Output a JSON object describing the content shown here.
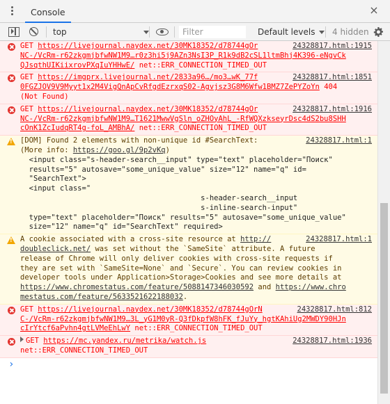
{
  "tabs": [
    {
      "label": "Console"
    }
  ],
  "toolbar": {
    "context": "top",
    "filter_placeholder": "Filter",
    "levels_label": "Default levels",
    "hidden_count": "4 hidden"
  },
  "messages": [
    {
      "type": "error",
      "method": "GET",
      "url_l1": "https://livejournal.naydex.net/30MK18352/d78744gOr",
      "url_l2": "NC-/VcRm-r62zkgmjbfwNW1M9…r0z3hi5j9AZn3NsI3P_R1k9dB2cSL1ltmBhj4K396-eNgvCk",
      "url_l3": "QJsqthUIKiixrovPXqIuYHHwE/",
      "tail": "net::ERR_CONNECTION_TIMED_OUT",
      "source": "24328817.html:1915"
    },
    {
      "type": "error",
      "method": "GET",
      "url_l1": "https://imgprx.livejournal.net/2833a96…/mo3…wK_77f",
      "url_l2": "0FGZJOV9V9Myyt1x2M4VigQnApCvRfgdEzrxqS02-Agvjsz3G8M6Wfw1BMZ7ZePYZoYn",
      "code": "404",
      "tail": "(Not Found)",
      "source": "24328817.html:1851"
    },
    {
      "type": "error",
      "method": "GET",
      "url_l1": "https://livejournal.naydex.net/30MK18352/d78744gOr",
      "url_l2": "NC-/VcRm-r62zkgmjbfwNW1M9…T1621MwwVgSln_oZHOyAhL_-RfWQXzkseyrDsc4dS2bu8SHH",
      "url_l3": "cOnK1ZcIudqRT4g-foL_AMBhA/",
      "tail": "net::ERR_CONNECTION_TIMED_OUT",
      "source": "24328817.html:1916"
    },
    {
      "type": "warn",
      "text_l1": "[DOM] Found 2 elements with non-unique id #SearchText:",
      "text_l2": "(More info: ",
      "link": "https://goo.gl/9p2vKq",
      "text_l2_end": ")",
      "source": "24328817.html:1",
      "code_lines": [
        "  <input class=\"s-header-search__input\" type=\"text\" placeholder=\"Поиск\"",
        "  results=\"5\" autosave=\"some_unique_value\" size=\"12\" name=\"q\" id=",
        "  \"SearchText\">",
        "  <input class=\"",
        "                                         s-header-search__input",
        "                                         s-inline-search-input\"",
        "  type=\"text\" placeholder=\"Поиск\" results=\"5\" autosave=\"some_unique_value\"",
        "  size=\"12\" name=\"q\" id=\"SearchText\" required>"
      ]
    },
    {
      "type": "warn",
      "pre": "A cookie associated with a cross-site resource at ",
      "link1_a": "http://",
      "link1_b": "doubleclick.net/",
      "rest_l1": " was set without the `SameSite` attribute. A future",
      "rest_l2": "release of Chrome will only deliver cookies with cross-site requests if",
      "rest_l3": "they are set with `SameSite=None` and `Secure`. You can review cookies in",
      "rest_l4": "developer tools under Application>Storage>Cookies and see more details at",
      "link2": "https://www.chromestatus.com/feature/5088147346030592",
      "and": " and ",
      "link3_a": "https://www.chro",
      "link3_b": "mestatus.com/feature/5633521622188032",
      "end": ".",
      "source": "24328817.html:1"
    },
    {
      "type": "error",
      "method": "GET",
      "url_l1": "https://livejournal.naydex.net/30MK18352/d78744gOrN",
      "url_l2": "C-/VcRm-r62zkgmjbfwNW1M9…3L_yG1M0yR-Q3fDkpfW8hFK_fJuYy_hgtKAhiUg2MWDY90HJn",
      "url_l3": "cIrYtcf6aPvhn4gtLVMeEhLwY",
      "tail": "net::ERR_CONNECTION_TIMED_OUT",
      "source": "24328817.html:812"
    },
    {
      "type": "error",
      "method": "GET",
      "url_l1": "https://mc.yandex.ru/metrika/watch.js",
      "tail": "net::ERR_CONNECTION_TIMED_OUT",
      "source": "24328817.html:1936"
    }
  ],
  "prompt_symbol": "›",
  "colors": {
    "error_bg": "#fff0f0",
    "warn_bg": "#fffbe5",
    "accent": "#1a73e8"
  },
  "icons": [
    "kebab-menu-icon",
    "close-icon",
    "sidebar-toggle-icon",
    "clear-console-icon",
    "eye-icon",
    "gear-icon",
    "error-icon",
    "warning-icon"
  ]
}
